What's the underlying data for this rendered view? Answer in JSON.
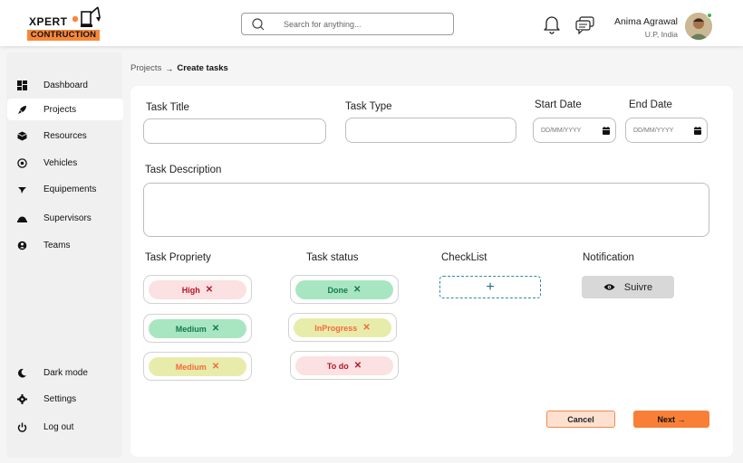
{
  "logo": {
    "text": "XPERT",
    "subtitle": "CONTRUCTION"
  },
  "search": {
    "placeholder": "Search for anything..."
  },
  "user": {
    "name": "Anima Agrawal",
    "location": "U.P, India"
  },
  "sidebar": {
    "items": [
      {
        "label": "Dashboard",
        "icon": "dashboard-icon"
      },
      {
        "label": "Projects",
        "icon": "rocket-icon",
        "active": true
      },
      {
        "label": "Resources",
        "icon": "box-icon"
      },
      {
        "label": "Vehicles",
        "icon": "vehicle-icon"
      },
      {
        "label": "Equipements",
        "icon": "equipment-icon"
      },
      {
        "label": "Supervisors",
        "icon": "helmet-icon"
      },
      {
        "label": "Teams",
        "icon": "team-icon"
      }
    ],
    "bottom": [
      {
        "label": "Dark mode",
        "icon": "moon-icon"
      },
      {
        "label": "Settings",
        "icon": "gear-icon"
      },
      {
        "label": "Log out",
        "icon": "power-icon"
      }
    ]
  },
  "breadcrumb": {
    "root": "Projects",
    "separator": "→",
    "current": "Create tasks"
  },
  "form": {
    "task_title_label": "Task Title",
    "task_type_label": "Task Type",
    "start_date_label": "Start Date",
    "end_date_label": "End Date",
    "date_placeholder": "DD/MM/YYYY",
    "description_label": "Task Description",
    "priority_label": "Task Propriety",
    "status_label": "Task status",
    "checklist_label": "CheckList",
    "notification_label": "Notification",
    "checklist_add": "+",
    "notification_button": "Suivre",
    "priorities": [
      {
        "label": "High",
        "bg": "#fbe1e1",
        "color": "#b5152b"
      },
      {
        "label": "Medium",
        "bg": "#a8e6c2",
        "color": "#127a4b"
      },
      {
        "label": "Medium",
        "bg": "#e8ecaa",
        "color": "#f46a3b"
      }
    ],
    "statuses": [
      {
        "label": "Done",
        "bg": "#a8e6c2",
        "color": "#127a4b"
      },
      {
        "label": "InProgress",
        "bg": "#e8ecaa",
        "color": "#f46a3b"
      },
      {
        "label": "To do",
        "bg": "#fbe1e1",
        "color": "#b5152b"
      }
    ],
    "remove_glyph": "✕",
    "cancel_button": "Cancel",
    "next_button": "Next →"
  },
  "colors": {
    "accent": "#f97f36",
    "checklist": "#2c8aa0"
  }
}
